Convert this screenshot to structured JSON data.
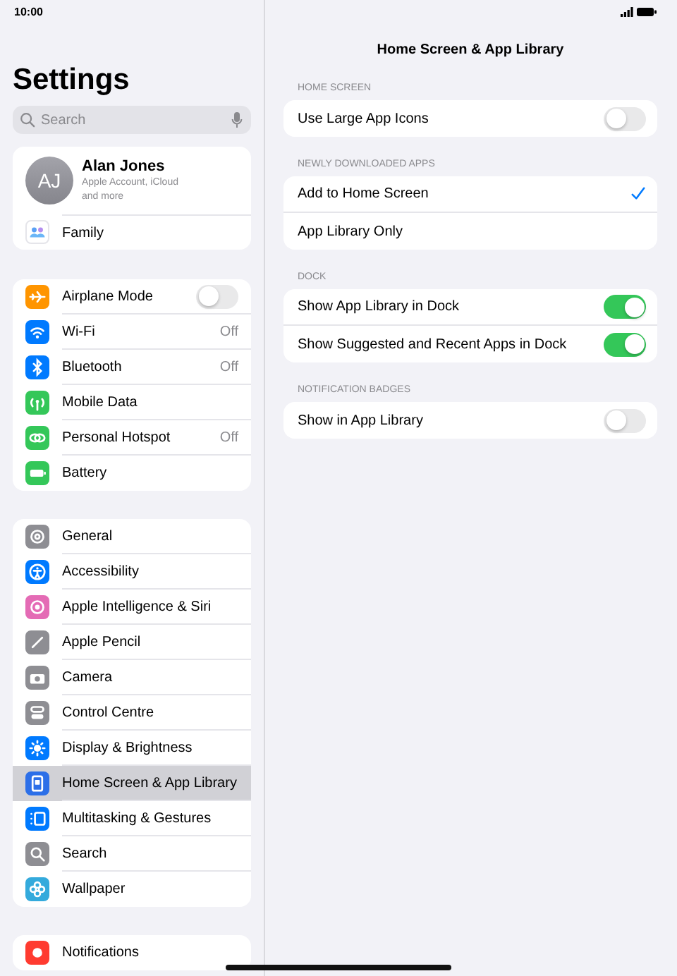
{
  "status_bar": {
    "time": "10:00"
  },
  "sidebar": {
    "title": "Settings",
    "search": {
      "placeholder": "Search"
    },
    "account": {
      "initials": "AJ",
      "name": "Alan Jones",
      "subtitle": "Apple Account, iCloud and more",
      "family": "Family"
    },
    "groups": [
      {
        "items": [
          {
            "label": "Airplane Mode",
            "kind": "toggle",
            "on": false,
            "color": "#ff9500",
            "selected": false
          },
          {
            "label": "Wi-Fi",
            "kind": "detail",
            "value": "Off",
            "color": "#007aff",
            "selected": false
          },
          {
            "label": "Bluetooth",
            "kind": "detail",
            "value": "Off",
            "color": "#007aff",
            "selected": false
          },
          {
            "label": "Mobile Data",
            "kind": "detail",
            "color": "#34c759",
            "selected": false
          },
          {
            "label": "Personal Hotspot",
            "kind": "detail",
            "value": "Off",
            "color": "#34c759",
            "selected": false
          },
          {
            "label": "Battery",
            "kind": "detail",
            "color": "#34c759",
            "selected": false
          }
        ]
      },
      {
        "items": [
          {
            "label": "General",
            "kind": "detail",
            "color": "#8e8e93",
            "selected": false
          },
          {
            "label": "Accessibility",
            "kind": "detail",
            "color": "#007aff",
            "selected": false
          },
          {
            "label": "Apple Intelligence & Siri",
            "kind": "detail",
            "color": "#e46bb5",
            "selected": false
          },
          {
            "label": "Apple Pencil",
            "kind": "detail",
            "color": "#8e8e93",
            "selected": false
          },
          {
            "label": "Camera",
            "kind": "detail",
            "color": "#8e8e93",
            "selected": false
          },
          {
            "label": "Control Centre",
            "kind": "detail",
            "color": "#8e8e93",
            "selected": false
          },
          {
            "label": "Display & Brightness",
            "kind": "detail",
            "color": "#007aff",
            "selected": false
          },
          {
            "label": "Home Screen & App Library",
            "kind": "detail",
            "color": "#2c6fe8",
            "selected": true
          },
          {
            "label": "Multitasking & Gestures",
            "kind": "detail",
            "color": "#007aff",
            "selected": false
          },
          {
            "label": "Search",
            "kind": "detail",
            "color": "#8e8e93",
            "selected": false
          },
          {
            "label": "Wallpaper",
            "kind": "detail",
            "color": "#34aadc",
            "selected": false
          }
        ]
      },
      {
        "items": [
          {
            "label": "Notifications",
            "kind": "detail",
            "color": "#ff3b30",
            "selected": false
          }
        ]
      }
    ]
  },
  "detail": {
    "title": "Home Screen & App Library",
    "sections": [
      {
        "header": "HOME SCREEN",
        "rows": [
          {
            "label": "Use Large App Icons",
            "kind": "toggle",
            "on": false
          }
        ]
      },
      {
        "header": "NEWLY DOWNLOADED APPS",
        "rows": [
          {
            "label": "Add to Home Screen",
            "kind": "choice",
            "selected": true
          },
          {
            "label": "App Library Only",
            "kind": "choice",
            "selected": false
          }
        ]
      },
      {
        "header": "DOCK",
        "rows": [
          {
            "label": "Show App Library in Dock",
            "kind": "toggle",
            "on": true
          },
          {
            "label": "Show Suggested and Recent Apps in Dock",
            "kind": "toggle",
            "on": true
          }
        ]
      },
      {
        "header": "NOTIFICATION BADGES",
        "rows": [
          {
            "label": "Show in App Library",
            "kind": "toggle",
            "on": false
          }
        ]
      }
    ]
  }
}
